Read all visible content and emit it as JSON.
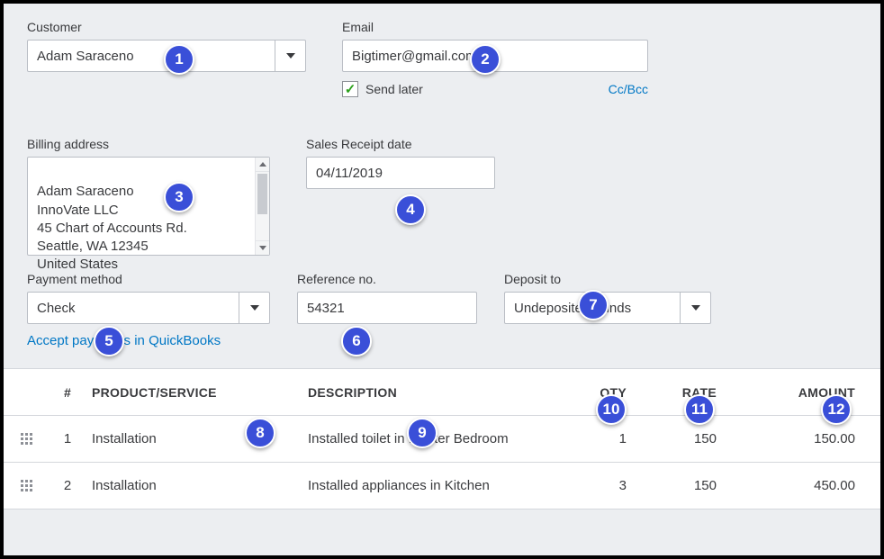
{
  "labels": {
    "customer": "Customer",
    "email": "Email",
    "send_later": "Send later",
    "cc_bcc": "Cc/Bcc",
    "billing_address": "Billing address",
    "receipt_date": "Sales Receipt date",
    "payment_method": "Payment method",
    "reference_no": "Reference no.",
    "deposit_to": "Deposit to",
    "accept_payments": "Accept payments in QuickBooks"
  },
  "fields": {
    "customer": "Adam Saraceno",
    "email": "Bigtimer@gmail.com",
    "send_later_checked": true,
    "billing_address": "Adam Saraceno\nInnoVate LLC\n45 Chart of Accounts Rd.\nSeattle, WA  12345\nUnited States",
    "receipt_date": "04/11/2019",
    "payment_method": "Check",
    "reference_no": "54321",
    "deposit_to": "Undeposited Funds"
  },
  "table": {
    "headers": {
      "num": "#",
      "product": "PRODUCT/SERVICE",
      "description": "DESCRIPTION",
      "qty": "QTY",
      "rate": "RATE",
      "amount": "AMOUNT"
    },
    "rows": [
      {
        "num": "1",
        "product": "Installation",
        "description": "Installed toilet in Master Bedroom",
        "qty": "1",
        "rate": "150",
        "amount": "150.00"
      },
      {
        "num": "2",
        "product": "Installation",
        "description": "Installed appliances in Kitchen",
        "qty": "3",
        "rate": "150",
        "amount": "450.00"
      }
    ]
  },
  "badges": [
    "1",
    "2",
    "3",
    "4",
    "5",
    "6",
    "7",
    "8",
    "9",
    "10",
    "11",
    "12"
  ]
}
